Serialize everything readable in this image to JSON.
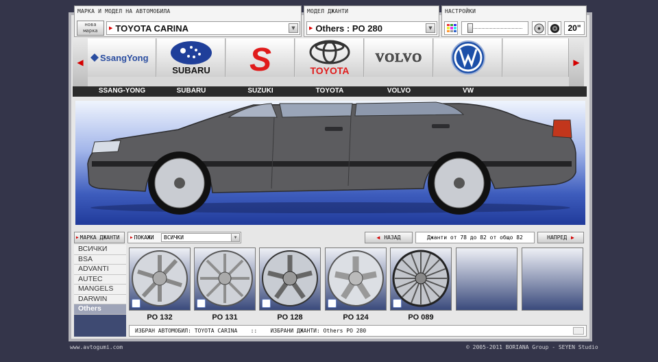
{
  "header": {
    "car_caption": "МАРКА И МОДЕЛ НА АВТОМОБИЛА",
    "new_make_label": "нова марка",
    "selected_car": "TOYOTA CARINA",
    "rim_caption": "МОДЕЛ ДЖАНТИ",
    "selected_rim": "Others : PO 280",
    "settings_caption": "НАСТРОЙКИ",
    "rim_size": "20\""
  },
  "brands": [
    {
      "logo_text": "SsangYong",
      "name": "SSANG-YONG"
    },
    {
      "logo_text": "SUBARU",
      "name": "SUBARU"
    },
    {
      "logo_text": "S",
      "name": "SUZUKI"
    },
    {
      "logo_text": "TOYOTA",
      "name": "TOYOTA"
    },
    {
      "logo_text": "VOLVO",
      "name": "VOLVO"
    },
    {
      "logo_text": "VW",
      "name": "VW"
    }
  ],
  "rims_panel": {
    "make_label": "МАРКА ДЖАНТИ",
    "show_label": "ПОКАЖИ",
    "show_value": "ВСИЧКИ",
    "back_label": "НАЗАД",
    "range_text": "Джанти от 78 до 82 от общо 82",
    "next_label": "НАПРЕД"
  },
  "makes": [
    "ВСИЧКИ",
    "BSA",
    "ADVANTI",
    "AUTEC",
    "MANGELS",
    "DARWIN",
    "Others"
  ],
  "selected_make": "Others",
  "rims": [
    "PO 132",
    "PO 131",
    "PO 128",
    "PO 124",
    "PO 089"
  ],
  "status": {
    "car_label": "ИЗБРАН АВТОМОБИЛ:",
    "car_value": "TOYOTA CARINA",
    "sep": "::",
    "rim_label": "ИЗБРАНИ ДЖАНТИ:",
    "rim_value": "Others PO 280"
  },
  "footer": {
    "site": "www.avtogumi.com",
    "copyright": "© 2005-2011 BORIANA Group - SEYEN Studio"
  },
  "colors": {
    "accent_red": "#d40000",
    "panel_navy": "#3e4a72",
    "bg": "#34354a"
  }
}
